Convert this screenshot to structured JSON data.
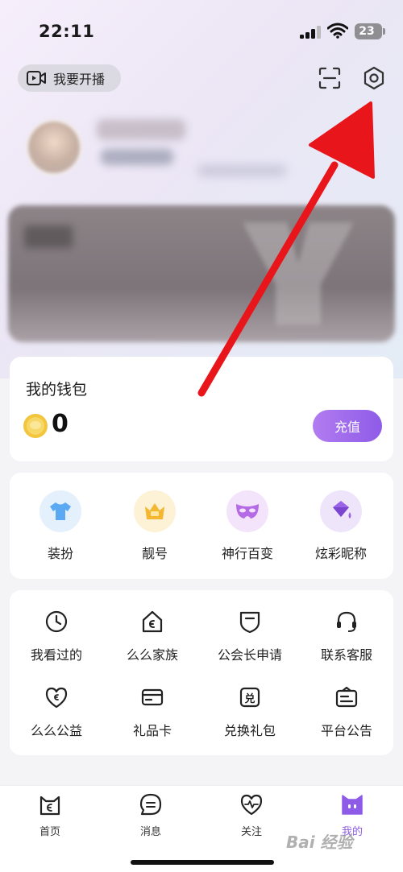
{
  "status_bar": {
    "time": "22:11",
    "battery": "23"
  },
  "header": {
    "live_button_label": "我要开播"
  },
  "wallet": {
    "title": "我的钱包",
    "balance": "0",
    "recharge_label": "充值"
  },
  "features": [
    {
      "label": "装扮",
      "icon": "tshirt-icon",
      "color": "#5aa9f2"
    },
    {
      "label": "靓号",
      "icon": "crown-icon",
      "color": "#f5b731"
    },
    {
      "label": "神行百变",
      "icon": "mask-icon",
      "color": "#b56ae6"
    },
    {
      "label": "炫彩昵称",
      "icon": "paint-bucket-icon",
      "color": "#9b63e8"
    }
  ],
  "tools": [
    {
      "label": "我看过的",
      "icon": "clock-icon"
    },
    {
      "label": "么么家族",
      "icon": "family-house-icon"
    },
    {
      "label": "公会长申请",
      "icon": "guild-badge-icon"
    },
    {
      "label": "联系客服",
      "icon": "headset-icon"
    },
    {
      "label": "么么公益",
      "icon": "charity-heart-icon"
    },
    {
      "label": "礼品卡",
      "icon": "gift-card-icon"
    },
    {
      "label": "兑换礼包",
      "icon": "redeem-icon"
    },
    {
      "label": "平台公告",
      "icon": "announcement-icon"
    }
  ],
  "tabs": [
    {
      "label": "首页",
      "icon": "home-cat-icon"
    },
    {
      "label": "消息",
      "icon": "message-icon"
    },
    {
      "label": "关注",
      "icon": "follow-heart-icon"
    },
    {
      "label": "我的",
      "icon": "profile-face-icon",
      "active": true
    }
  ],
  "accent_color": "#8e5be8",
  "annotation_color": "#e8161b",
  "watermark": "Bai 经验"
}
